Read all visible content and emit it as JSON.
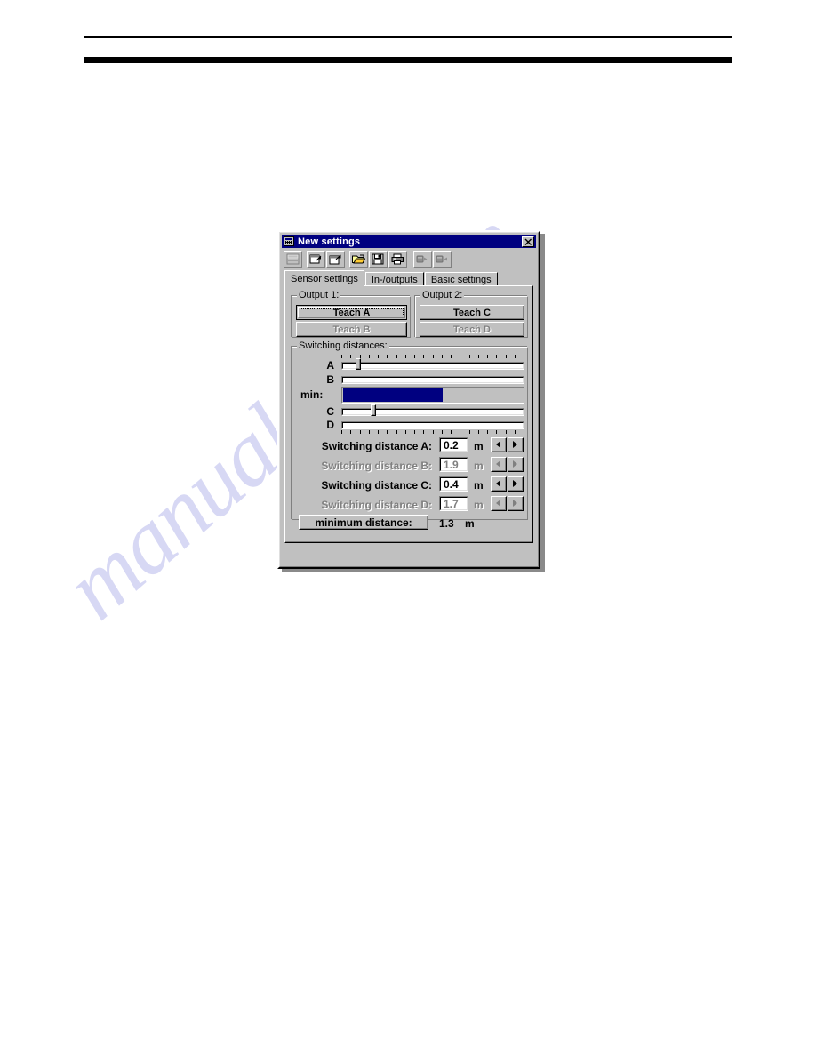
{
  "page": {
    "watermark": "manualslib.com"
  },
  "window": {
    "title": "New settings",
    "title_icon": "window-grid-icon",
    "close_icon": "close-icon",
    "toolbar": [
      {
        "name": "new-button",
        "icon": "new-document-icon",
        "disabled": true
      },
      {
        "name": "window-restore-button",
        "icon": "window-restore-icon",
        "disabled": false
      },
      {
        "name": "window-maximize-button",
        "icon": "window-maximize-icon",
        "disabled": false
      },
      {
        "name": "open-button",
        "icon": "open-folder-icon",
        "disabled": false
      },
      {
        "name": "save-button",
        "icon": "floppy-save-icon",
        "disabled": false
      },
      {
        "name": "print-button",
        "icon": "printer-icon",
        "disabled": false
      },
      {
        "name": "upload-button",
        "icon": "transfer-out-icon",
        "disabled": true
      },
      {
        "name": "download-button",
        "icon": "transfer-in-icon",
        "disabled": true
      }
    ],
    "tabs": [
      {
        "label": "Sensor settings",
        "active": true
      },
      {
        "label": "In-/outputs",
        "active": false
      },
      {
        "label": "Basic settings",
        "active": false
      }
    ],
    "output1": {
      "legend": "Output 1:",
      "teach_a": "Teach A",
      "teach_b": "Teach B"
    },
    "output2": {
      "legend": "Output 2:",
      "teach_c": "Teach C",
      "teach_d": "Teach D"
    },
    "switching": {
      "legend": "Switching distances:",
      "slider_a_letter": "A",
      "slider_b_letter": "B",
      "min_letter": "min:",
      "slider_c_letter": "C",
      "slider_d_letter": "D",
      "rows": [
        {
          "label": "Switching distance A:",
          "value": "0.2",
          "unit": "m",
          "disabled": false
        },
        {
          "label": "Switching distance B:",
          "value": "1.9",
          "unit": "m",
          "disabled": true
        },
        {
          "label": "Switching distance C:",
          "value": "0.4",
          "unit": "m",
          "disabled": false
        },
        {
          "label": "Switching distance D:",
          "value": "1.7",
          "unit": "m",
          "disabled": true
        }
      ],
      "minimum_button": "minimum distance:",
      "minimum_value": "1.3",
      "minimum_unit": "m"
    }
  },
  "colors": {
    "titlebar": "#000080",
    "face": "#c0c0c0",
    "bar_fill": "#000080",
    "disabled_text": "#808080",
    "watermark": "#c9caf0"
  }
}
